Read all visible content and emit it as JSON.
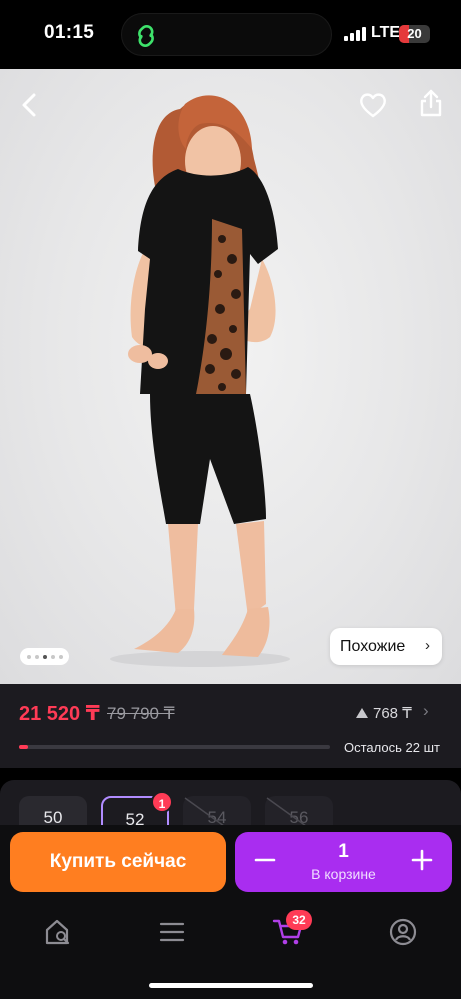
{
  "status_bar": {
    "time": "01:15",
    "network": "LTE",
    "battery": "20",
    "battery_color": "#e5393b",
    "island_icon": "green-link-icon"
  },
  "photo": {
    "description_icon": "product-photo",
    "back_icon": "chevron-left-icon",
    "favorite_icon": "heart-icon",
    "share_icon": "share-icon",
    "similar_label": "Похожие",
    "gallery_pages": 5,
    "gallery_current": 3
  },
  "price": {
    "current": "21 520 ₸",
    "old": "79 790 ₸",
    "views": "768 ₸",
    "stock_text": "Осталось 22 шт",
    "stock_fraction": 0.03,
    "accent": "#ff3b56"
  },
  "sizes": {
    "items": [
      {
        "label": "50",
        "state": "available"
      },
      {
        "label": "52",
        "state": "selected"
      },
      {
        "label": "54",
        "state": "unavailable"
      },
      {
        "label": "56",
        "state": "unavailable"
      }
    ],
    "selected_badge": "1"
  },
  "actions": {
    "buy_now": "Купить сейчас",
    "buy_color": "#ff7e20",
    "cart_qty": "1",
    "cart_label": "В корзине",
    "cart_color": "#a92df0"
  },
  "tabs": {
    "items": [
      "home-search-icon",
      "menu-icon",
      "cart-icon",
      "profile-icon"
    ],
    "cart_badge": "32"
  }
}
